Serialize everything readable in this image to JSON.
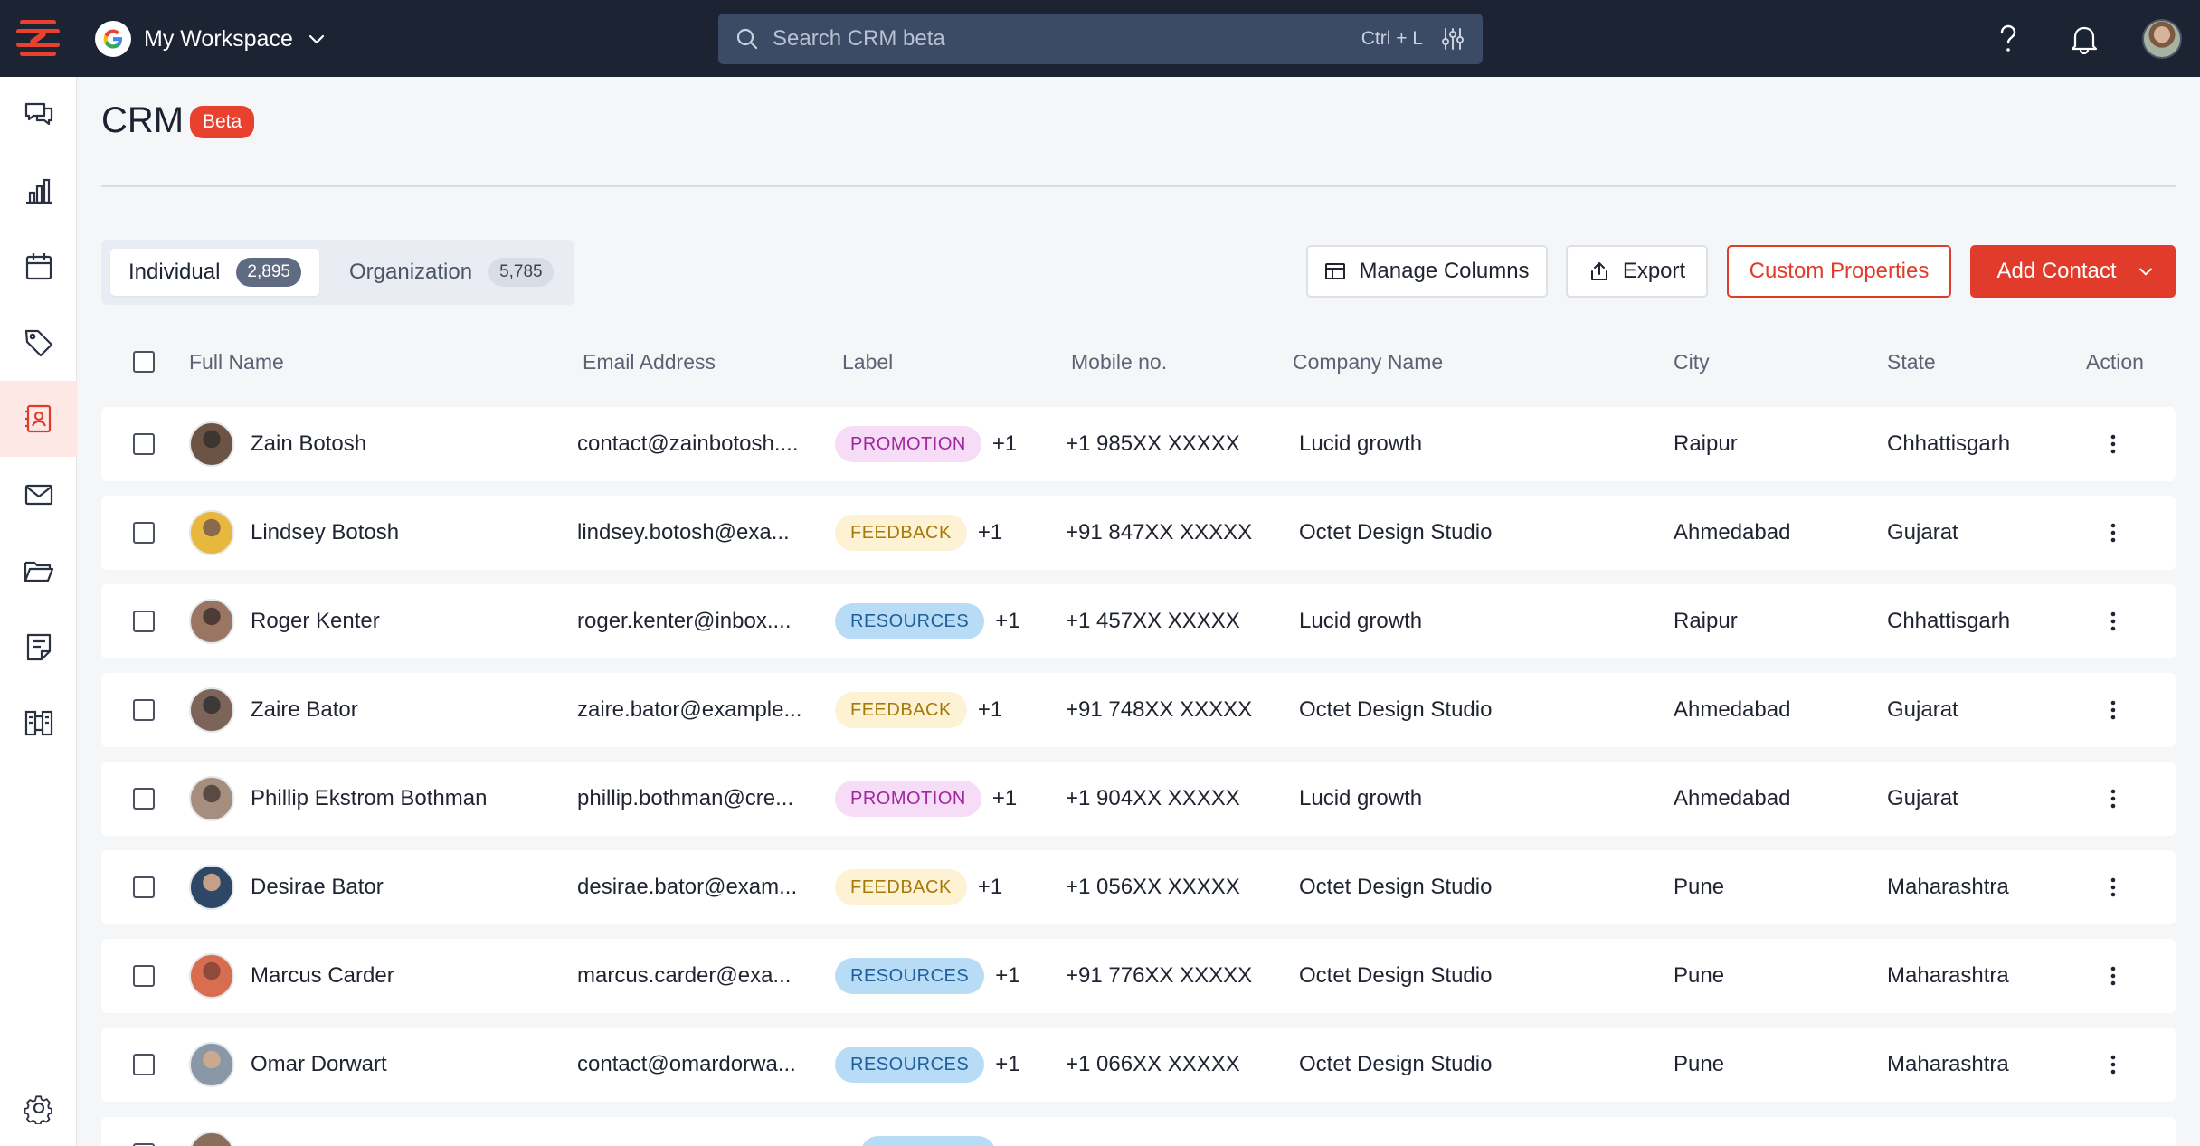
{
  "topbar": {
    "workspace_name": "My Workspace",
    "search_placeholder": "Search CRM beta",
    "search_shortcut": "Ctrl + L"
  },
  "sidebar": {
    "items": [
      {
        "icon": "chat-icon"
      },
      {
        "icon": "bar-chart-icon"
      },
      {
        "icon": "calendar-icon"
      },
      {
        "icon": "tag-icon"
      },
      {
        "icon": "contacts-icon",
        "active": true
      },
      {
        "icon": "mail-icon"
      },
      {
        "icon": "folder-icon"
      },
      {
        "icon": "notes-icon"
      },
      {
        "icon": "templates-icon"
      },
      {
        "icon": "settings-icon"
      }
    ]
  },
  "page": {
    "title": "CRM",
    "badge": "Beta"
  },
  "tabs": [
    {
      "label": "Individual",
      "count": "2,895",
      "active": true
    },
    {
      "label": "Organization",
      "count": "5,785",
      "active": false
    }
  ],
  "actions": {
    "manage_columns": "Manage Columns",
    "export": "Export",
    "custom_properties": "Custom Properties",
    "add_contact": "Add Contact"
  },
  "table": {
    "columns": [
      "Full Name",
      "Email Address",
      "Label",
      "Mobile no.",
      "Company Name",
      "City",
      "State",
      "Action"
    ],
    "rows": [
      {
        "name": "Zain Botosh",
        "email": "contact@zainbotosh....",
        "label": "PROMOTION",
        "label_more": "+1",
        "mobile": "+1 985XX XXXXX",
        "company": "Lucid growth",
        "city": "Raipur",
        "state": "Chhattisgarh"
      },
      {
        "name": "Lindsey Botosh",
        "email": "lindsey.botosh@exa...",
        "label": "FEEDBACK",
        "label_more": "+1",
        "mobile": "+91 847XX XXXXX",
        "company": "Octet Design Studio",
        "city": "Ahmedabad",
        "state": "Gujarat"
      },
      {
        "name": "Roger Kenter",
        "email": "roger.kenter@inbox....",
        "label": "RESOURCES",
        "label_more": "+1",
        "mobile": "+1 457XX XXXXX",
        "company": "Lucid growth",
        "city": "Raipur",
        "state": "Chhattisgarh"
      },
      {
        "name": "Zaire Bator",
        "email": "zaire.bator@example...",
        "label": "FEEDBACK",
        "label_more": "+1",
        "mobile": "+91 748XX XXXXX",
        "company": "Octet Design Studio",
        "city": "Ahmedabad",
        "state": "Gujarat"
      },
      {
        "name": "Phillip Ekstrom Bothman",
        "email": "phillip.bothman@cre...",
        "label": "PROMOTION",
        "label_more": "+1",
        "mobile": "+1 904XX XXXXX",
        "company": "Lucid growth",
        "city": "Ahmedabad",
        "state": "Gujarat"
      },
      {
        "name": "Desirae Bator",
        "email": "desirae.bator@exam...",
        "label": "FEEDBACK",
        "label_more": "+1",
        "mobile": "+1 056XX XXXXX",
        "company": "Octet Design Studio",
        "city": "Pune",
        "state": "Maharashtra"
      },
      {
        "name": "Marcus Carder",
        "email": "marcus.carder@exa...",
        "label": "RESOURCES",
        "label_more": "+1",
        "mobile": "+91 776XX XXXXX",
        "company": "Octet Design Studio",
        "city": "Pune",
        "state": "Maharashtra"
      },
      {
        "name": "Omar Dorwart",
        "email": "contact@omardorwa...",
        "label": "RESOURCES",
        "label_more": "+1",
        "mobile": "+1 066XX XXXXX",
        "company": "Octet Design Studio",
        "city": "Pune",
        "state": "Maharashtra"
      }
    ]
  },
  "colors": {
    "accent": "#e13c2b",
    "topbar": "#1c2434",
    "promotion_bg": "#f7dcf7",
    "promotion_fg": "#a1279f",
    "feedback_bg": "#fdf2d3",
    "feedback_fg": "#a67a0a",
    "resources_bg": "#b9dcf6",
    "resources_fg": "#1e5f9b"
  }
}
